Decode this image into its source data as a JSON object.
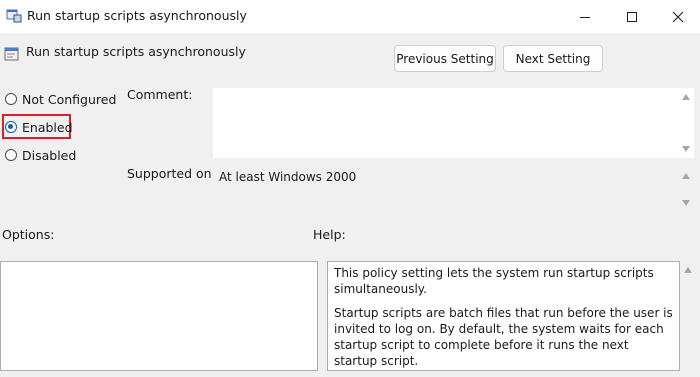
{
  "window": {
    "title": "Run startup scripts asynchronously"
  },
  "header": {
    "policy_name": "Run startup scripts asynchronously",
    "previous_label": "Previous Setting",
    "next_label": "Next Setting"
  },
  "state_options": [
    {
      "label": "Not Configured",
      "selected": false
    },
    {
      "label": "Enabled",
      "selected": true
    },
    {
      "label": "Disabled",
      "selected": false
    }
  ],
  "comment": {
    "label": "Comment:",
    "value": ""
  },
  "supported": {
    "label": "Supported on:",
    "value": "At least Windows 2000"
  },
  "options": {
    "label": "Options:"
  },
  "help": {
    "label": "Help:",
    "paragraphs": [
      "This policy setting lets the system run startup scripts simultaneously.",
      "Startup scripts are batch files that run before the user is invited to log on. By default, the system waits for each startup script to complete before it runs the next startup script."
    ]
  },
  "colors": {
    "highlight": "#d4232b",
    "radio_accent": "#0a5fb8"
  }
}
